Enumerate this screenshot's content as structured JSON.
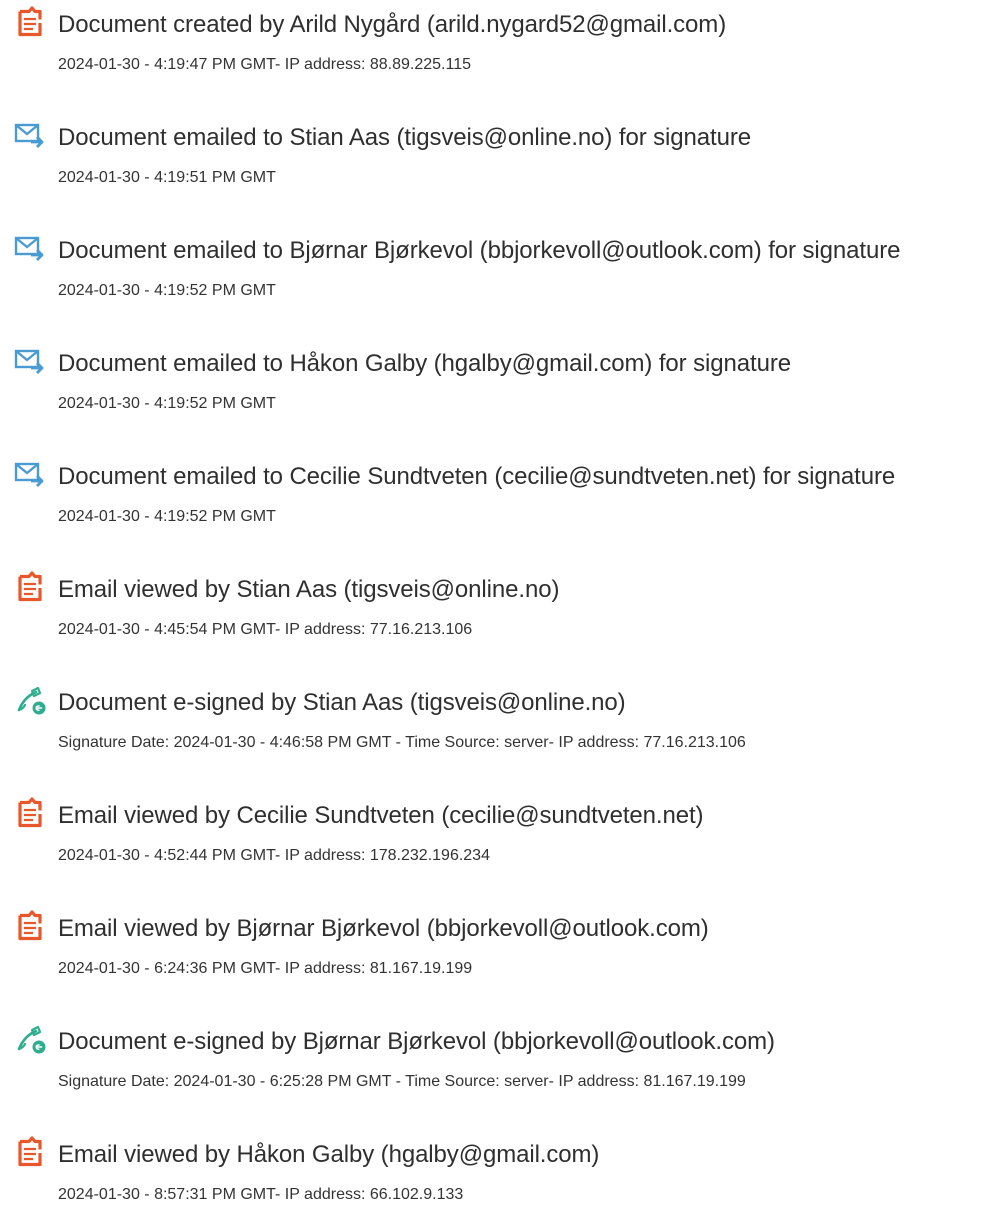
{
  "events": [
    {
      "icon": "document-created-icon",
      "title": "Document created by Arild Nygård (arild.nygard52@gmail.com)",
      "detail": "2024-01-30 - 4:19:47 PM GMT- IP address: 88.89.225.115"
    },
    {
      "icon": "email-sent-icon",
      "title": "Document emailed to Stian Aas (tigsveis@online.no) for signature",
      "detail": "2024-01-30 - 4:19:51 PM GMT"
    },
    {
      "icon": "email-sent-icon",
      "title": "Document emailed to Bjørnar Bjørkevol (bbjorkevoll@outlook.com) for signature",
      "detail": "2024-01-30 - 4:19:52 PM GMT"
    },
    {
      "icon": "email-sent-icon",
      "title": "Document emailed to Håkon Galby (hgalby@gmail.com) for signature",
      "detail": "2024-01-30 - 4:19:52 PM GMT"
    },
    {
      "icon": "email-sent-icon",
      "title": "Document emailed to Cecilie Sundtveten (cecilie@sundtveten.net) for signature",
      "detail": "2024-01-30 - 4:19:52 PM GMT"
    },
    {
      "icon": "document-viewed-icon",
      "title": "Email viewed by Stian Aas (tigsveis@online.no)",
      "detail": "2024-01-30 - 4:45:54 PM GMT- IP address: 77.16.213.106"
    },
    {
      "icon": "e-sign-icon",
      "title": "Document e-signed by Stian Aas (tigsveis@online.no)",
      "detail": "Signature Date: 2024-01-30 - 4:46:58 PM GMT - Time Source: server- IP address: 77.16.213.106"
    },
    {
      "icon": "document-viewed-icon",
      "title": "Email viewed by Cecilie Sundtveten (cecilie@sundtveten.net)",
      "detail": "2024-01-30 - 4:52:44 PM GMT- IP address: 178.232.196.234"
    },
    {
      "icon": "document-viewed-icon",
      "title": "Email viewed by Bjørnar Bjørkevol (bbjorkevoll@outlook.com)",
      "detail": "2024-01-30 - 6:24:36 PM GMT- IP address: 81.167.19.199"
    },
    {
      "icon": "e-sign-icon",
      "title": "Document e-signed by Bjørnar Bjørkevol (bbjorkevoll@outlook.com)",
      "detail": "Signature Date: 2024-01-30 - 6:25:28 PM GMT - Time Source: server- IP address: 81.167.19.199"
    },
    {
      "icon": "document-viewed-icon",
      "title": "Email viewed by Håkon Galby (hgalby@gmail.com)",
      "detail": "2024-01-30 - 8:57:31 PM GMT- IP address: 66.102.9.133"
    }
  ],
  "colors": {
    "document_icon": "#e8562b",
    "email_icon": "#4a9bd4",
    "esign_icon": "#2eae8e",
    "title_text": "#2f2f2f",
    "detail_text": "#333333"
  }
}
